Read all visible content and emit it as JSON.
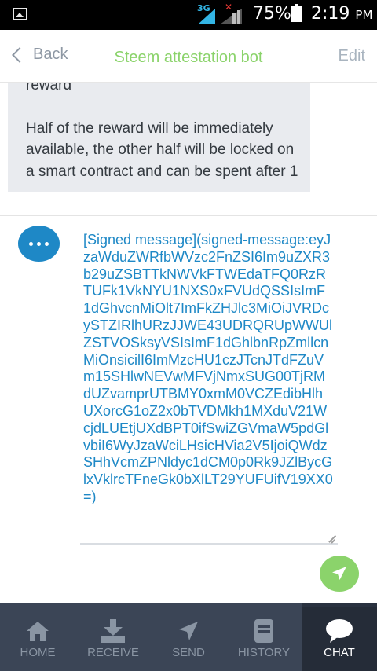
{
  "status_bar": {
    "network": "3G",
    "battery": "75%",
    "time": "2:19",
    "ampm": "PM"
  },
  "header": {
    "back_label": "Back",
    "title": "Steem attestation bot",
    "edit_label": "Edit"
  },
  "message": {
    "line_top": "reward",
    "paragraph": "Half of the reward will be immediately available, the other half will be locked on a smart contract and can be spent after 1"
  },
  "composer": {
    "value": "[Signed message](signed-message:eyJzaWduZWRfbWVzc2FnZSI6Im9uZXR3b29uZSBTTkNWVkFTWEdaTFQ0RzRTUFk1VkNYU1NXS0xFVUdQSSIsImF1dGhvcnMiOlt7ImFkZHJlc3MiOiJVRDcySTZIRlhURzJJWE43UDRQRUpWWUlZSTVOSksyVSIsImF1dGhlbnRpZmllcnMiOnsicilI6ImMzcHU1czJTcnJTdFZuVm15SHlwNEVwMFVjNmxSUG00TjRMdUZvamprUTBMY0xmM0VCZEdibHlhUXorcG1oZ2x0bTVDMkh1MXduV21WcjdLUEtjUXdBPT0ifSwiZGVmaW5pdGlvbiI6WyJzaWciLHsicHVia2V5IjoiQWdzSHhVcmZPNldyc1dCM0p0Rk9JZlBycGlxVklrcTFneGk0bXlLT29YUFUifV19XX0=)"
  },
  "tabs": [
    {
      "label": "HOME",
      "icon": "home-icon"
    },
    {
      "label": "RECEIVE",
      "icon": "download-icon"
    },
    {
      "label": "SEND",
      "icon": "send-icon"
    },
    {
      "label": "HISTORY",
      "icon": "history-icon"
    },
    {
      "label": "CHAT",
      "icon": "chat-icon"
    }
  ],
  "colors": {
    "accent_green": "#8bd36b",
    "accent_blue": "#1e88c6",
    "tabbar_bg": "#3b4556"
  }
}
